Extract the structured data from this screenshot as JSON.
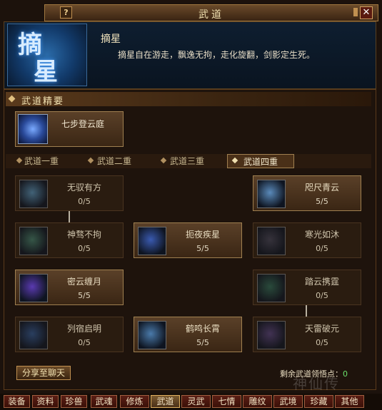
{
  "window": {
    "title": "武道",
    "help": "?",
    "close": "✕"
  },
  "header": {
    "art_chars": [
      "摘",
      "星"
    ],
    "skill_name": "摘星",
    "skill_desc": "摘星自在游走，飘逸无拘，走化旋翻，剑影定生死。"
  },
  "section": {
    "title": "武道精要"
  },
  "main_skill": {
    "name": "七步登云庭",
    "icon": "cloud-step-icon"
  },
  "tabs": [
    {
      "label": "武道一重",
      "active": false
    },
    {
      "label": "武道二重",
      "active": false
    },
    {
      "label": "武道三重",
      "active": false
    },
    {
      "label": "武道四重",
      "active": true
    }
  ],
  "nodes": [
    {
      "name": "无驭有方",
      "level": "0/5",
      "lit": false,
      "icon": "hand-glow-icon",
      "color": "#4a7a9a"
    },
    {
      "name": "咫尺青云",
      "level": "5/5",
      "lit": true,
      "icon": "hand-glow-icon",
      "color": "#5a8aba"
    },
    {
      "name": "神骛不拘",
      "level": "0/5",
      "lit": false,
      "icon": "swirl-icon",
      "color": "#3a6a5a"
    },
    {
      "name": "扼夜疾星",
      "level": "5/5",
      "lit": true,
      "icon": "star-orbs-icon",
      "color": "#3a5ab0"
    },
    {
      "name": "寒光如沐",
      "level": "0/5",
      "lit": false,
      "icon": "ice-shard-icon",
      "color": "#3a3a4a"
    },
    {
      "name": "密云缠月",
      "level": "5/5",
      "lit": true,
      "icon": "moon-swirl-icon",
      "color": "#5a3ab0"
    },
    {
      "name": "踏云携霆",
      "level": "0/5",
      "lit": false,
      "icon": "thunder-step-icon",
      "color": "#2a5a4a"
    },
    {
      "name": "列宿启明",
      "level": "0/5",
      "lit": false,
      "icon": "constellation-icon",
      "color": "#2a4a7a"
    },
    {
      "name": "鹤鸣长霄",
      "level": "5/5",
      "lit": true,
      "icon": "crane-call-icon",
      "color": "#4a7aaa"
    },
    {
      "name": "天雷破元",
      "level": "0/5",
      "lit": false,
      "icon": "thunder-break-icon",
      "color": "#4a3a6a"
    }
  ],
  "share_label": "分享至聊天",
  "points": {
    "label": "剩余武道领悟点：",
    "value": "0"
  },
  "watermark": "神仙传",
  "bottom_tabs": [
    {
      "label": "装备",
      "active": false
    },
    {
      "label": "资料",
      "active": false
    },
    {
      "label": "珍兽",
      "active": false
    },
    {
      "label": "武魂",
      "active": false
    },
    {
      "label": "修炼",
      "active": false
    },
    {
      "label": "武道",
      "active": true
    },
    {
      "label": "灵武",
      "active": false
    },
    {
      "label": "七情",
      "active": false
    },
    {
      "label": "雕纹",
      "active": false
    },
    {
      "label": "武境",
      "active": false
    },
    {
      "label": "珍藏",
      "active": false
    },
    {
      "label": "其他",
      "active": false
    }
  ]
}
